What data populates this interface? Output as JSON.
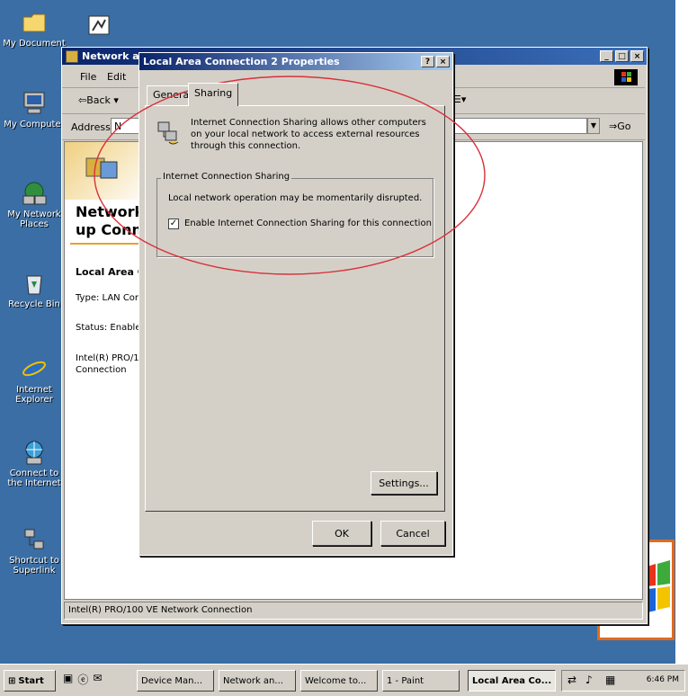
{
  "desktop_icons": [
    {
      "name": "my-documents-icon",
      "label": "My Document"
    },
    {
      "name": "my-computer-icon",
      "label": "My Computer"
    },
    {
      "name": "my-network-places-icon",
      "label": "My Network Places"
    },
    {
      "name": "recycle-bin-icon",
      "label": "Recycle Bin"
    },
    {
      "name": "internet-explorer-icon",
      "label": "Internet Explorer"
    },
    {
      "name": "connect-to-internet-icon",
      "label": "Connect to the Internet"
    },
    {
      "name": "shortcut-superlink-icon",
      "label": "Shortcut to Superlink"
    }
  ],
  "explorer": {
    "title": "Network an",
    "menu_file": "File",
    "menu_edit": "Edit",
    "back_label": "Back",
    "address_label": "Address",
    "address_value": "N",
    "go_label": "Go",
    "heading_line1": "Network",
    "heading_line2": "up Conn",
    "item_title": "Local Area C",
    "item_type": "Type: LAN Cor",
    "item_status": "Status: Enable",
    "item_device_line1": "Intel(R) PRO/1",
    "item_device_line2": "Connection",
    "status_bar": "Intel(R) PRO/100 VE Network Connection"
  },
  "dialog": {
    "title": "Local Area Connection 2 Properties",
    "help_btn": "?",
    "close_btn": "×",
    "tab_general": "General",
    "tab_sharing": "Sharing",
    "description": "Internet Connection Sharing allows other computers on your local network to access external resources through this connection.",
    "group_label": "Internet Connection Sharing",
    "warning": "Local network operation may be momentarily disrupted.",
    "checkbox_label": "Enable Internet Connection Sharing for this connection",
    "checkbox_checked": true,
    "settings_btn": "Settings...",
    "ok_btn": "OK",
    "cancel_btn": "Cancel"
  },
  "taskbar": {
    "start": "Start",
    "items": [
      "Device Man...",
      "Network an...",
      "Welcome to...",
      "1 - Paint",
      "Local Area Co..."
    ],
    "clock": "6:46 PM"
  },
  "colors": {
    "desktop": "#3a6ea5",
    "highlight_circle": "#d9303a",
    "titlebar_active": "#0a246a"
  }
}
